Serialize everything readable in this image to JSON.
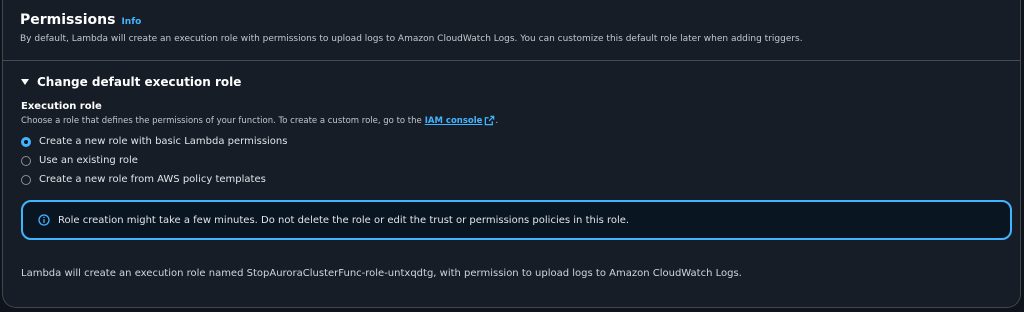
{
  "header": {
    "title": "Permissions",
    "info_link": "Info",
    "description": "By default, Lambda will create an execution role with permissions to upload logs to Amazon CloudWatch Logs. You can customize this default role later when adding triggers."
  },
  "expander": {
    "label": "Change default execution role",
    "expanded": true
  },
  "execution_role": {
    "label": "Execution role",
    "description_prefix": "Choose a role that defines the permissions of your function. To create a custom role, go to the",
    "link_text": "IAM console",
    "description_suffix": "."
  },
  "radio_options": [
    {
      "label": "Create a new role with basic Lambda permissions",
      "checked": true
    },
    {
      "label": "Use an existing role",
      "checked": false
    },
    {
      "label": "Create a new role from AWS policy templates",
      "checked": false
    }
  ],
  "alert": {
    "text": "Role creation might take a few minutes. Do not delete the role or edit the trust or permissions policies in this role."
  },
  "footer": {
    "text": "Lambda will create an execution role named StopAuroraClusterFunc-role-untxqdtg, with permission to upload logs to Amazon CloudWatch Logs."
  },
  "colors": {
    "accent": "#42b4ff",
    "panel_bg": "#161d26",
    "page_bg": "#0f141a"
  }
}
